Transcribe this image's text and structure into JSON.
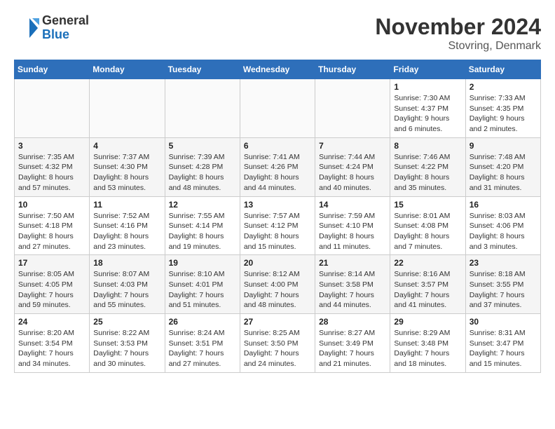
{
  "header": {
    "logo_line1": "General",
    "logo_line2": "Blue",
    "month_title": "November 2024",
    "location": "Stovring, Denmark"
  },
  "weekdays": [
    "Sunday",
    "Monday",
    "Tuesday",
    "Wednesday",
    "Thursday",
    "Friday",
    "Saturday"
  ],
  "weeks": [
    [
      {
        "day": "",
        "info": ""
      },
      {
        "day": "",
        "info": ""
      },
      {
        "day": "",
        "info": ""
      },
      {
        "day": "",
        "info": ""
      },
      {
        "day": "",
        "info": ""
      },
      {
        "day": "1",
        "info": "Sunrise: 7:30 AM\nSunset: 4:37 PM\nDaylight: 9 hours\nand 6 minutes."
      },
      {
        "day": "2",
        "info": "Sunrise: 7:33 AM\nSunset: 4:35 PM\nDaylight: 9 hours\nand 2 minutes."
      }
    ],
    [
      {
        "day": "3",
        "info": "Sunrise: 7:35 AM\nSunset: 4:32 PM\nDaylight: 8 hours\nand 57 minutes."
      },
      {
        "day": "4",
        "info": "Sunrise: 7:37 AM\nSunset: 4:30 PM\nDaylight: 8 hours\nand 53 minutes."
      },
      {
        "day": "5",
        "info": "Sunrise: 7:39 AM\nSunset: 4:28 PM\nDaylight: 8 hours\nand 48 minutes."
      },
      {
        "day": "6",
        "info": "Sunrise: 7:41 AM\nSunset: 4:26 PM\nDaylight: 8 hours\nand 44 minutes."
      },
      {
        "day": "7",
        "info": "Sunrise: 7:44 AM\nSunset: 4:24 PM\nDaylight: 8 hours\nand 40 minutes."
      },
      {
        "day": "8",
        "info": "Sunrise: 7:46 AM\nSunset: 4:22 PM\nDaylight: 8 hours\nand 35 minutes."
      },
      {
        "day": "9",
        "info": "Sunrise: 7:48 AM\nSunset: 4:20 PM\nDaylight: 8 hours\nand 31 minutes."
      }
    ],
    [
      {
        "day": "10",
        "info": "Sunrise: 7:50 AM\nSunset: 4:18 PM\nDaylight: 8 hours\nand 27 minutes."
      },
      {
        "day": "11",
        "info": "Sunrise: 7:52 AM\nSunset: 4:16 PM\nDaylight: 8 hours\nand 23 minutes."
      },
      {
        "day": "12",
        "info": "Sunrise: 7:55 AM\nSunset: 4:14 PM\nDaylight: 8 hours\nand 19 minutes."
      },
      {
        "day": "13",
        "info": "Sunrise: 7:57 AM\nSunset: 4:12 PM\nDaylight: 8 hours\nand 15 minutes."
      },
      {
        "day": "14",
        "info": "Sunrise: 7:59 AM\nSunset: 4:10 PM\nDaylight: 8 hours\nand 11 minutes."
      },
      {
        "day": "15",
        "info": "Sunrise: 8:01 AM\nSunset: 4:08 PM\nDaylight: 8 hours\nand 7 minutes."
      },
      {
        "day": "16",
        "info": "Sunrise: 8:03 AM\nSunset: 4:06 PM\nDaylight: 8 hours\nand 3 minutes."
      }
    ],
    [
      {
        "day": "17",
        "info": "Sunrise: 8:05 AM\nSunset: 4:05 PM\nDaylight: 7 hours\nand 59 minutes."
      },
      {
        "day": "18",
        "info": "Sunrise: 8:07 AM\nSunset: 4:03 PM\nDaylight: 7 hours\nand 55 minutes."
      },
      {
        "day": "19",
        "info": "Sunrise: 8:10 AM\nSunset: 4:01 PM\nDaylight: 7 hours\nand 51 minutes."
      },
      {
        "day": "20",
        "info": "Sunrise: 8:12 AM\nSunset: 4:00 PM\nDaylight: 7 hours\nand 48 minutes."
      },
      {
        "day": "21",
        "info": "Sunrise: 8:14 AM\nSunset: 3:58 PM\nDaylight: 7 hours\nand 44 minutes."
      },
      {
        "day": "22",
        "info": "Sunrise: 8:16 AM\nSunset: 3:57 PM\nDaylight: 7 hours\nand 41 minutes."
      },
      {
        "day": "23",
        "info": "Sunrise: 8:18 AM\nSunset: 3:55 PM\nDaylight: 7 hours\nand 37 minutes."
      }
    ],
    [
      {
        "day": "24",
        "info": "Sunrise: 8:20 AM\nSunset: 3:54 PM\nDaylight: 7 hours\nand 34 minutes."
      },
      {
        "day": "25",
        "info": "Sunrise: 8:22 AM\nSunset: 3:53 PM\nDaylight: 7 hours\nand 30 minutes."
      },
      {
        "day": "26",
        "info": "Sunrise: 8:24 AM\nSunset: 3:51 PM\nDaylight: 7 hours\nand 27 minutes."
      },
      {
        "day": "27",
        "info": "Sunrise: 8:25 AM\nSunset: 3:50 PM\nDaylight: 7 hours\nand 24 minutes."
      },
      {
        "day": "28",
        "info": "Sunrise: 8:27 AM\nSunset: 3:49 PM\nDaylight: 7 hours\nand 21 minutes."
      },
      {
        "day": "29",
        "info": "Sunrise: 8:29 AM\nSunset: 3:48 PM\nDaylight: 7 hours\nand 18 minutes."
      },
      {
        "day": "30",
        "info": "Sunrise: 8:31 AM\nSunset: 3:47 PM\nDaylight: 7 hours\nand 15 minutes."
      }
    ]
  ]
}
